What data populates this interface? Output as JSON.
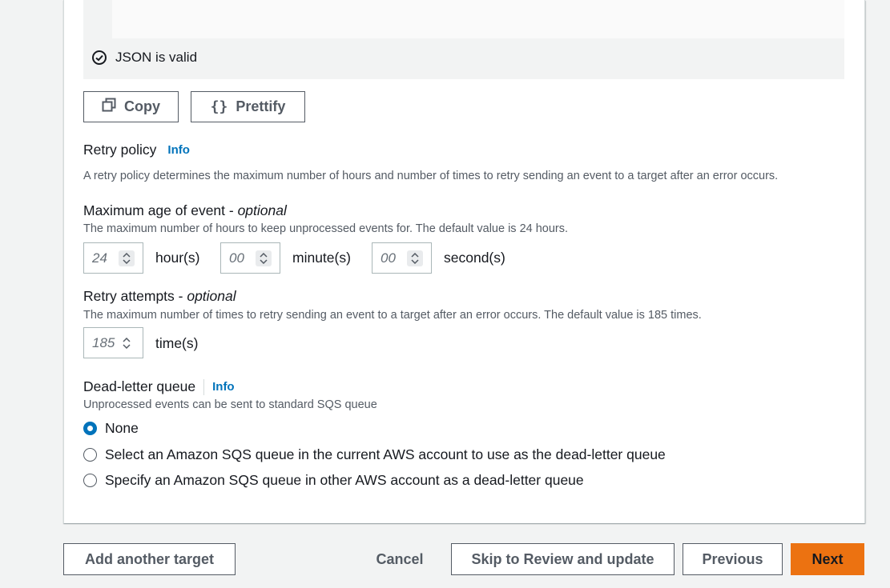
{
  "json_panel": {
    "valid_text": "JSON is valid"
  },
  "buttons": {
    "copy": "Copy",
    "prettify": "Prettify"
  },
  "retry_policy": {
    "title": "Retry policy",
    "info": "Info",
    "description": "A retry policy determines the maximum number of hours and number of times to retry sending an event to a target after an error occurs."
  },
  "max_age": {
    "label": "Maximum age of event - ",
    "optional": "optional",
    "description": "The maximum number of hours to keep unprocessed events for. The default value is 24 hours.",
    "hours_placeholder": "24",
    "hours_unit": "hour(s)",
    "minutes_placeholder": "00",
    "minutes_unit": "minute(s)",
    "seconds_placeholder": "00",
    "seconds_unit": "second(s)"
  },
  "retry_attempts": {
    "label": "Retry attempts - ",
    "optional": "optional",
    "description": "The maximum number of times to retry sending an event to a target after an error occurs. The default value is 185 times.",
    "times_placeholder": "185",
    "times_unit": "time(s)"
  },
  "dlq": {
    "title": "Dead-letter queue",
    "info": "Info",
    "description": "Unprocessed events can be sent to standard SQS queue",
    "options": [
      {
        "label": "None",
        "selected": true
      },
      {
        "label": "Select an Amazon SQS queue in the current AWS account to use as the dead-letter queue",
        "selected": false
      },
      {
        "label": "Specify an Amazon SQS queue in other AWS account as a dead-letter queue",
        "selected": false
      }
    ]
  },
  "footer": {
    "add_target": "Add another target",
    "cancel": "Cancel",
    "skip": "Skip to Review and update",
    "previous": "Previous",
    "next": "Next"
  },
  "colors": {
    "accent": "#0073bb",
    "primary_button": "#ec7211"
  }
}
